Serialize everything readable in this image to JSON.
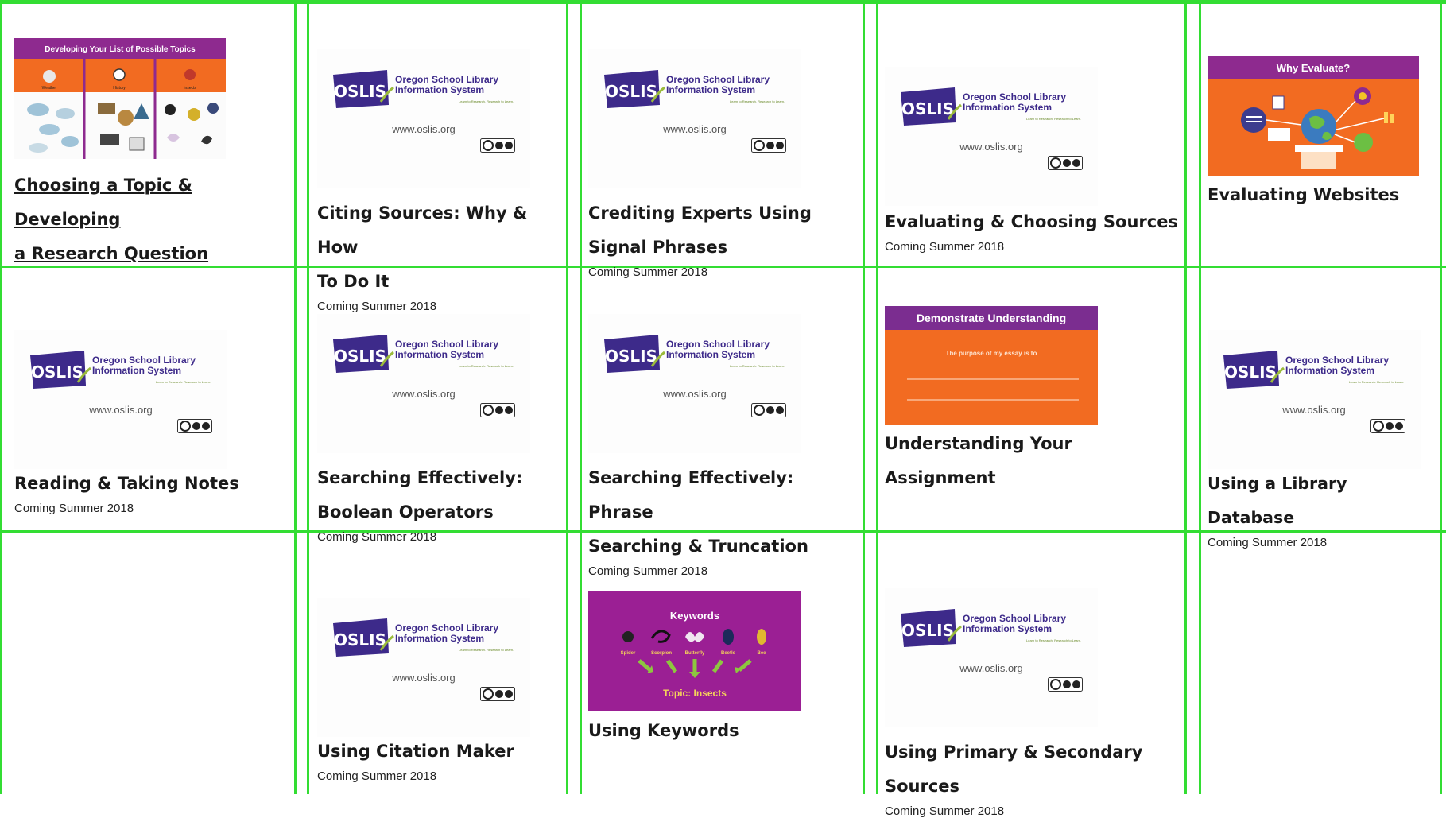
{
  "page": {
    "background": "#ffffff",
    "grid_color": "#33dd33"
  },
  "oslis": {
    "brand": "OSLIS",
    "line1": "Oregon School Library",
    "line2": "Information System",
    "tagline": "Learn to Research. Research to Learn.",
    "url": "www.oslis.org",
    "brand_color": "#3d2a8a",
    "leaf_color": "#9bbb3b"
  },
  "status_text": "Coming Summer 2018",
  "tiles": [
    {
      "title_line1": "Choosing a Topic & Developing",
      "title_line2": "a Research Question",
      "is_link": true,
      "status": "",
      "thumb": {
        "kind": "topics",
        "header": "Developing Your List of Possible Topics",
        "labels": [
          "Weather",
          "History",
          "Insects"
        ]
      }
    },
    {
      "title_line1": "Citing Sources: Why & How",
      "title_line2": "To Do It",
      "status": "Coming Summer 2018",
      "thumb": {
        "kind": "oslis"
      }
    },
    {
      "title_line1": "Crediting Experts Using",
      "title_line2": "Signal Phrases",
      "status": "Coming Summer 2018",
      "thumb": {
        "kind": "oslis"
      }
    },
    {
      "title_line1": "Evaluating & Choosing Sources",
      "title_line2": "",
      "status": "Coming Summer 2018",
      "thumb": {
        "kind": "oslis"
      }
    },
    {
      "title_line1": "Evaluating Websites",
      "title_line2": "",
      "status": "",
      "thumb": {
        "kind": "evaluate",
        "header": "Why Evaluate?"
      }
    },
    {
      "title_line1": "Reading & Taking Notes",
      "title_line2": "",
      "status": "Coming Summer 2018",
      "thumb": {
        "kind": "oslis"
      }
    },
    {
      "title_line1": "Searching Effectively:",
      "title_line2": "Boolean Operators",
      "status": "Coming Summer 2018",
      "thumb": {
        "kind": "oslis"
      }
    },
    {
      "title_line1": "Searching Effectively: Phrase",
      "title_line2": "Searching & Truncation",
      "status": "Coming Summer 2018",
      "thumb": {
        "kind": "oslis"
      }
    },
    {
      "title_line1": "Understanding Your Assignment",
      "title_line2": "",
      "status": "",
      "thumb": {
        "kind": "demonstrate",
        "header": "Demonstrate Understanding",
        "prompt": "The purpose of my essay is to"
      }
    },
    {
      "title_line1": "Using a Library Database",
      "title_line2": "",
      "status": "Coming  Summer 2018",
      "thumb": {
        "kind": "oslis"
      }
    },
    {
      "title_line1": "Using Citation Maker",
      "title_line2": "",
      "status": "Coming Summer 2018",
      "thumb": {
        "kind": "oslis"
      }
    },
    {
      "title_line1": "Using Keywords",
      "title_line2": "",
      "status": "",
      "thumb": {
        "kind": "keywords",
        "header": "Keywords",
        "words": [
          "Spider",
          "Scorpion",
          "Butterfly",
          "Beetle",
          "Bee"
        ],
        "topic": "Topic: Insects"
      }
    },
    {
      "title_line1": "Using Primary & Secondary",
      "title_line2": "Sources",
      "status": "Coming Summer 2018",
      "thumb": {
        "kind": "oslis"
      }
    }
  ],
  "colors": {
    "orange": "#f26b21",
    "purple": "#8e2a8f",
    "demo_purple": "#7b2d90",
    "keywords_purple": "#9b1f94",
    "arrow_green": "#8dc63f"
  }
}
